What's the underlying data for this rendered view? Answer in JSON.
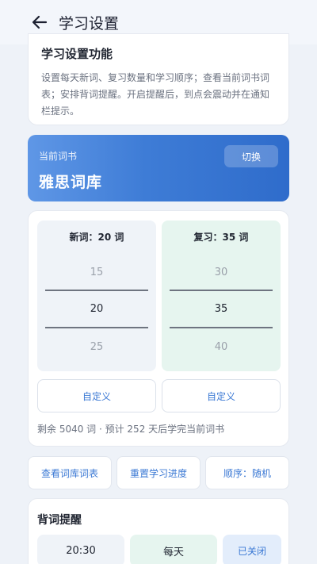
{
  "appbar": {
    "title": "学习设置"
  },
  "intro": {
    "heading": "学习设置功能",
    "description": "设置每天新词、复习数量和学习顺序；查看当前词书词表；安排背词提醒。开启提醒后，到点会震动并在通知栏提示。"
  },
  "book": {
    "label": "当前词书",
    "name": "雅思词库",
    "switch_label": "切换"
  },
  "plan": {
    "new": {
      "header": "新词：20 词",
      "options": [
        "15",
        "20",
        "25"
      ]
    },
    "review": {
      "header": "复习：35 词",
      "options": [
        "30",
        "35",
        "40"
      ]
    },
    "custom_label": "自定义",
    "remaining": "剩余 5040 词 · 预计 252 天后学完当前词书"
  },
  "actions": {
    "view_list": "查看词库词表",
    "reset_progress": "重置学习进度",
    "order": "顺序：随机"
  },
  "reminder": {
    "heading": "背词提醒",
    "time": "20:30",
    "frequency": "每天",
    "state": "已关闭"
  },
  "colors": {
    "accent": "#3a78d4",
    "book_gradient_start": "#5f97e6",
    "book_gradient_end": "#2f6ccb",
    "review_bg": "#e6f5ef"
  }
}
